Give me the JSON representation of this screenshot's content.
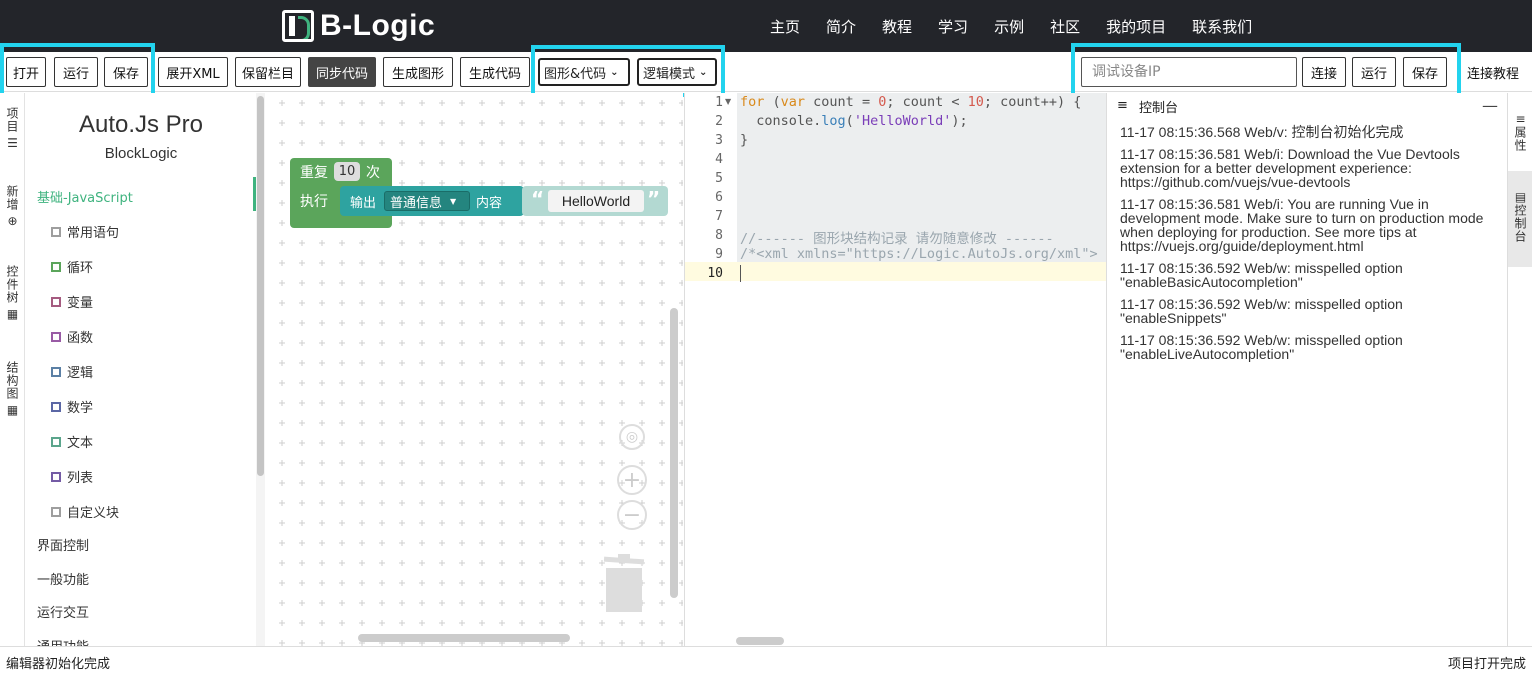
{
  "brand": {
    "name": "B-Logic"
  },
  "nav": [
    "主页",
    "简介",
    "教程",
    "学习",
    "示例",
    "社区",
    "我的项目",
    "联系我们"
  ],
  "toolbar": {
    "open": "打开",
    "run": "运行",
    "save": "保存",
    "expand_xml": "展开XML",
    "keep_bar": "保留栏目",
    "sync_code": "同步代码",
    "gen_graphic": "生成图形",
    "gen_code": "生成代码",
    "view_select": "图形&代码",
    "mode_select": "逻辑模式",
    "ip_placeholder": "调试设备IP",
    "connect": "连接",
    "run2": "运行",
    "save2": "保存",
    "connect_tutorial": "连接教程"
  },
  "left_tabs": [
    "项目",
    "新增",
    "控件树",
    "结构图"
  ],
  "categories": {
    "title": "Auto.Js Pro",
    "subtitle": "BlockLogic",
    "active": "基础-JavaScript",
    "sub": [
      {
        "label": "常用语句",
        "color": "#9e9e9e"
      },
      {
        "label": "循环",
        "color": "#5ba55b"
      },
      {
        "label": "变量",
        "color": "#a55b80"
      },
      {
        "label": "函数",
        "color": "#995ba5"
      },
      {
        "label": "逻辑",
        "color": "#5b80a5"
      },
      {
        "label": "数学",
        "color": "#5b67a5"
      },
      {
        "label": "文本",
        "color": "#5ba58c"
      },
      {
        "label": "列表",
        "color": "#745ba5"
      },
      {
        "label": "自定义块",
        "color": "#9e9e9e"
      }
    ],
    "others": [
      "界面控制",
      "一般功能",
      "运行交互",
      "通用功能"
    ]
  },
  "blocks": {
    "repeat": "重复",
    "times": "次",
    "count": "10",
    "exec": "执行",
    "print": "输出",
    "level": "普通信息",
    "content": "内容",
    "string": "HelloWorld"
  },
  "editor": {
    "lines": [
      "1",
      "2",
      "3",
      "4",
      "5",
      "6",
      "7",
      "8",
      "9",
      "10"
    ],
    "code_comment": "//------ 图形块结构记录 请勿随意修改 ------",
    "code_xml": "/*<xml xmlns=\"https://Logic.AutoJs.org/xml\">"
  },
  "console": {
    "title": "控制台",
    "logs": [
      "11-17 08:15:36.568 Web/v: 控制台初始化完成",
      "11-17 08:15:36.581 Web/i: Download the Vue Devtools extension for a better development experience: https://github.com/vuejs/vue-devtools",
      "11-17 08:15:36.581 Web/i: You are running Vue in development mode. Make sure to turn on production mode when deploying for production. See more tips at https://vuejs.org/guide/deployment.html",
      "11-17 08:15:36.592 Web/w: misspelled option \"enableBasicAutocompletion\"",
      "11-17 08:15:36.592 Web/w: misspelled option \"enableSnippets\"",
      "11-17 08:15:36.592 Web/w: misspelled option \"enableLiveAutocompletion\""
    ]
  },
  "right_tabs": [
    "属性",
    "控制台"
  ],
  "status": {
    "left": "编辑器初始化完成",
    "right": "项目打开完成"
  },
  "colors": {
    "accent": "#3fb37f",
    "highlight": "#22d3ee",
    "nav_bg": "#23252a"
  }
}
